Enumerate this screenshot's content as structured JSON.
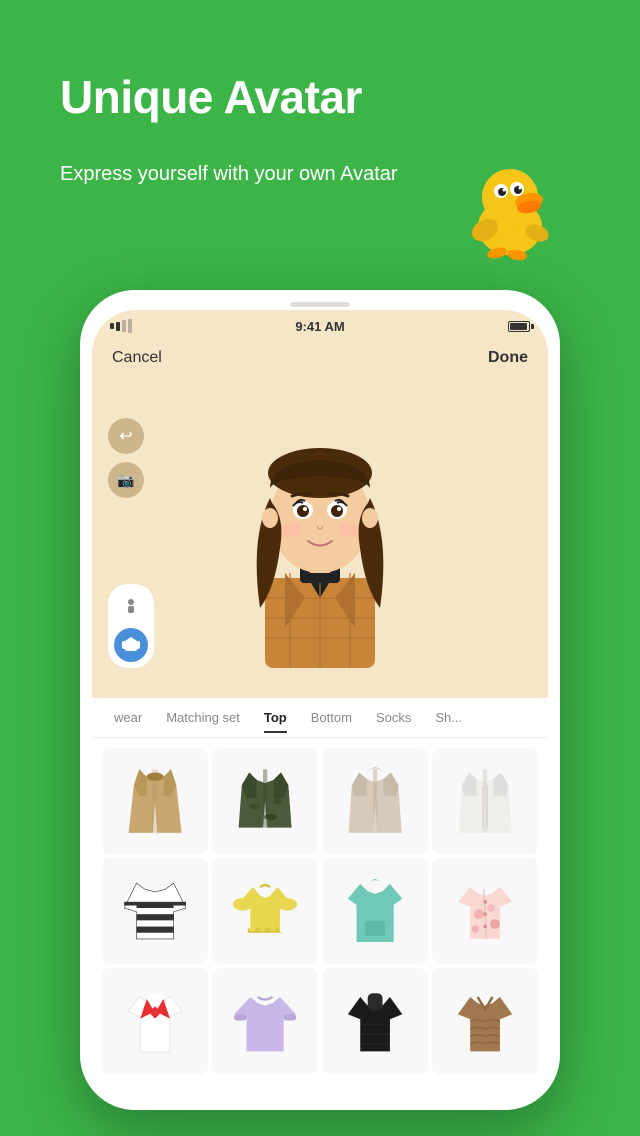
{
  "hero": {
    "title": "Unique Avatar",
    "subtitle": "Express yourself with\nyour own Avatar",
    "bg_color": "#3cb448"
  },
  "phone": {
    "status_bar": {
      "time": "9:41 AM"
    },
    "header": {
      "cancel_label": "Cancel",
      "done_label": "Done"
    },
    "categories": [
      {
        "id": "outwear",
        "label": "wear"
      },
      {
        "id": "matching",
        "label": "Matching set"
      },
      {
        "id": "top",
        "label": "Top",
        "active": true
      },
      {
        "id": "bottom",
        "label": "Bottom"
      },
      {
        "id": "socks",
        "label": "Socks"
      },
      {
        "id": "shoes",
        "label": "Sh..."
      }
    ],
    "tools": [
      {
        "icon": "↩",
        "name": "undo"
      },
      {
        "icon": "📷",
        "name": "camera"
      }
    ]
  },
  "colors": {
    "green": "#3cb448",
    "avatar_bg": "#f5e6c8",
    "tab_active": "#222222",
    "tab_inactive": "#888888"
  }
}
